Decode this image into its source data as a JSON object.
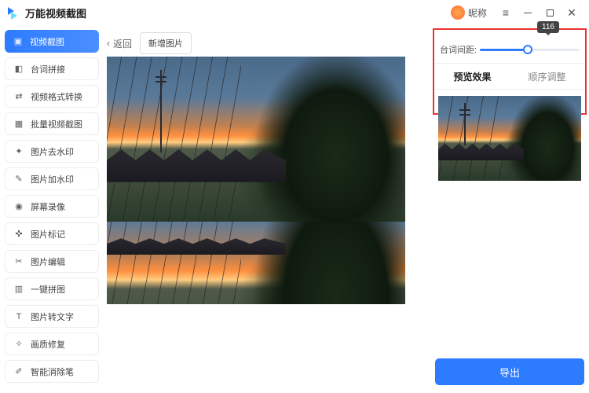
{
  "titlebar": {
    "app_name": "万能视频截图",
    "nickname": "昵称"
  },
  "sidebar": {
    "items": [
      {
        "label": "视频截图",
        "icon": "video-cut-icon"
      },
      {
        "label": "台词拼接",
        "icon": "splice-icon"
      },
      {
        "label": "视频格式转换",
        "icon": "convert-icon"
      },
      {
        "label": "批量视频截图",
        "icon": "batch-icon"
      },
      {
        "label": "图片去水印",
        "icon": "remove-watermark-icon"
      },
      {
        "label": "图片加水印",
        "icon": "add-watermark-icon"
      },
      {
        "label": "屏幕录像",
        "icon": "record-icon"
      },
      {
        "label": "图片标记",
        "icon": "mark-icon"
      },
      {
        "label": "图片编辑",
        "icon": "edit-icon"
      },
      {
        "label": "一键拼图",
        "icon": "puzzle-icon"
      },
      {
        "label": "图片转文字",
        "icon": "ocr-icon"
      },
      {
        "label": "画质修复",
        "icon": "enhance-icon"
      },
      {
        "label": "智能消除笔",
        "icon": "erase-icon"
      }
    ]
  },
  "main": {
    "back_label": "返回",
    "add_image_label": "新增图片"
  },
  "right": {
    "slider_label": "台词间距:",
    "slider_value": "116",
    "tabs": {
      "preview": "预览效果",
      "order": "顺序调整"
    },
    "export_label": "导出"
  }
}
